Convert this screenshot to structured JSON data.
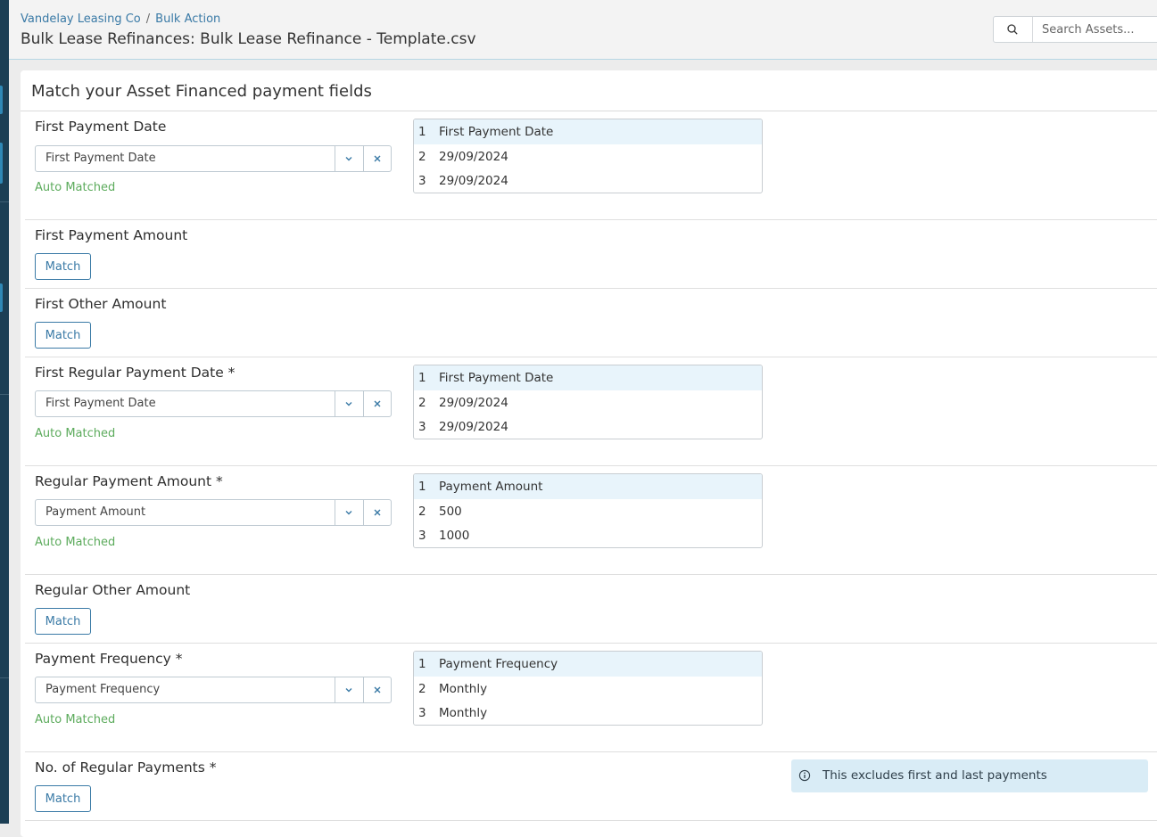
{
  "breadcrumb": {
    "company": "Vandelay Leasing Co",
    "separator": "/",
    "section": "Bulk Action"
  },
  "page_title": "Bulk Lease Refinances: Bulk Lease Refinance - Template.csv",
  "search": {
    "placeholder": "Search Assets..."
  },
  "card": {
    "title": "Match your Asset Financed payment fields"
  },
  "match_label": "Match",
  "auto_matched_label": "Auto Matched",
  "fields": [
    {
      "label": "First Payment Date",
      "selected": "First Payment Date",
      "preview": [
        {
          "n": "1",
          "v": "First Payment Date"
        },
        {
          "n": "2",
          "v": "29/09/2024"
        },
        {
          "n": "3",
          "v": "29/09/2024"
        }
      ]
    },
    {
      "label": "First Payment Amount"
    },
    {
      "label": "First Other Amount"
    },
    {
      "label": "First Regular Payment Date *",
      "selected": "First Payment Date",
      "preview": [
        {
          "n": "1",
          "v": "First Payment Date"
        },
        {
          "n": "2",
          "v": "29/09/2024"
        },
        {
          "n": "3",
          "v": "29/09/2024"
        }
      ]
    },
    {
      "label": "Regular Payment Amount *",
      "selected": "Payment Amount",
      "preview": [
        {
          "n": "1",
          "v": "Payment Amount"
        },
        {
          "n": "2",
          "v": "500"
        },
        {
          "n": "3",
          "v": "1000"
        }
      ]
    },
    {
      "label": "Regular Other Amount"
    },
    {
      "label": "Payment Frequency *",
      "selected": "Payment Frequency",
      "preview": [
        {
          "n": "1",
          "v": "Payment Frequency"
        },
        {
          "n": "2",
          "v": "Monthly"
        },
        {
          "n": "3",
          "v": "Monthly"
        }
      ]
    },
    {
      "label": "No. of Regular Payments *",
      "info": "This excludes first and last payments"
    }
  ],
  "colors": {
    "accent": "#3a7aa6",
    "auto_matched": "#5cab5c",
    "rail": "#1c3f55",
    "info_bg": "#d9ecf6"
  }
}
